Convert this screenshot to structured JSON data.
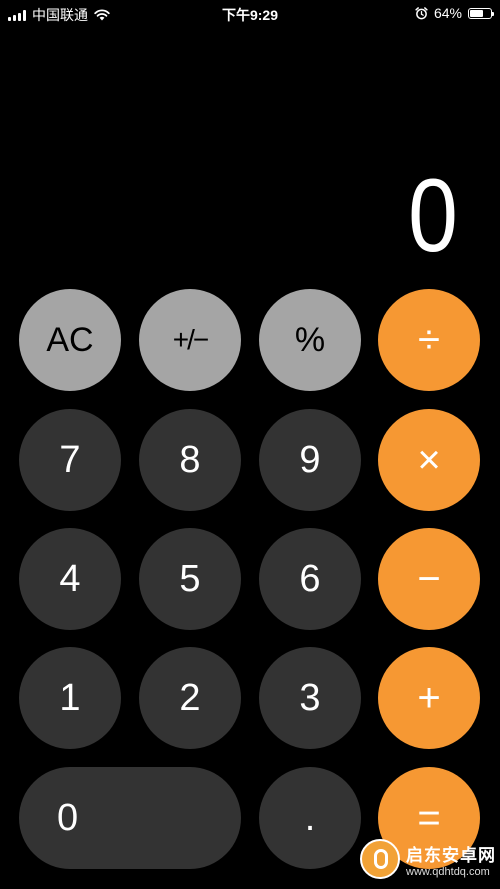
{
  "status_bar": {
    "carrier": "中国联通",
    "time": "下午9:29",
    "battery_percent": "64%",
    "battery_level": 0.64,
    "icons": [
      "signal-icon",
      "wifi-icon",
      "alarm-icon",
      "battery-icon"
    ]
  },
  "display": {
    "value": "0"
  },
  "keys": {
    "ac": "AC",
    "sign": "+/−",
    "percent": "%",
    "divide": "÷",
    "seven": "7",
    "eight": "8",
    "nine": "9",
    "multiply": "×",
    "four": "4",
    "five": "5",
    "six": "6",
    "subtract": "−",
    "one": "1",
    "two": "2",
    "three": "3",
    "add": "+",
    "zero": "0",
    "decimal": ".",
    "equals": "="
  },
  "colors": {
    "background": "#000000",
    "function_key": "#a5a5a5",
    "number_key": "#333333",
    "operator_key": "#f69833"
  },
  "watermark": {
    "title": "启东安卓网",
    "url": "www.qdhtdq.com"
  }
}
